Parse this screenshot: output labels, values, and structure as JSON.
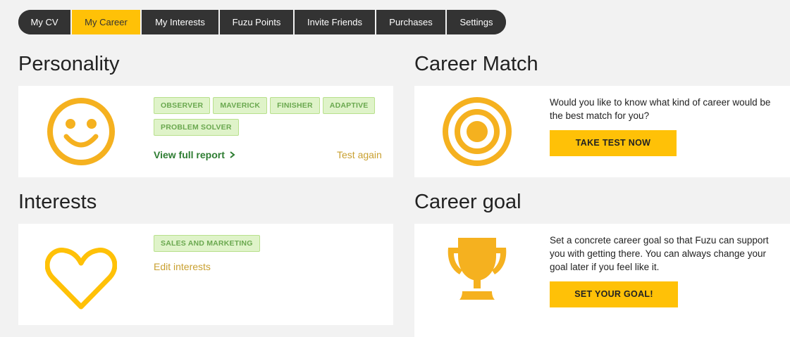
{
  "nav": {
    "items": [
      {
        "label": "My CV"
      },
      {
        "label": "My Career"
      },
      {
        "label": "My Interests"
      },
      {
        "label": "Fuzu Points"
      },
      {
        "label": "Invite Friends"
      },
      {
        "label": "Purchases"
      },
      {
        "label": "Settings"
      }
    ],
    "active_label": "My Career"
  },
  "personality": {
    "title": "Personality",
    "tags": [
      "OBSERVER",
      "MAVERICK",
      "FINISHER",
      "ADAPTIVE",
      "PROBLEM SOLVER"
    ],
    "view_report": "View full report",
    "view_report_icon": "chevron-right-icon",
    "test_again": "Test again",
    "icon": "smiley-icon"
  },
  "interests": {
    "title": "Interests",
    "tags": [
      "SALES AND MARKETING"
    ],
    "edit": "Edit interests",
    "icon": "heart-icon"
  },
  "career_match": {
    "title": "Career Match",
    "description": "Would you like to know what kind of career would be the best match for you?",
    "button": "TAKE TEST NOW",
    "icon": "target-icon"
  },
  "career_goal": {
    "title": "Career goal",
    "description": "Set a concrete career goal so that Fuzu can support you with getting there. You can always change your goal later if you feel like it.",
    "button": "SET YOUR GOAL!",
    "icon": "trophy-icon"
  },
  "colors": {
    "accent": "#ffc107",
    "icon_gold": "#f5b11f",
    "nav_bg": "#333333",
    "tag_bg": "#dff3c9",
    "tag_text": "#6aa84f",
    "link_green": "#2e7d32",
    "link_gold": "#c9a030"
  }
}
